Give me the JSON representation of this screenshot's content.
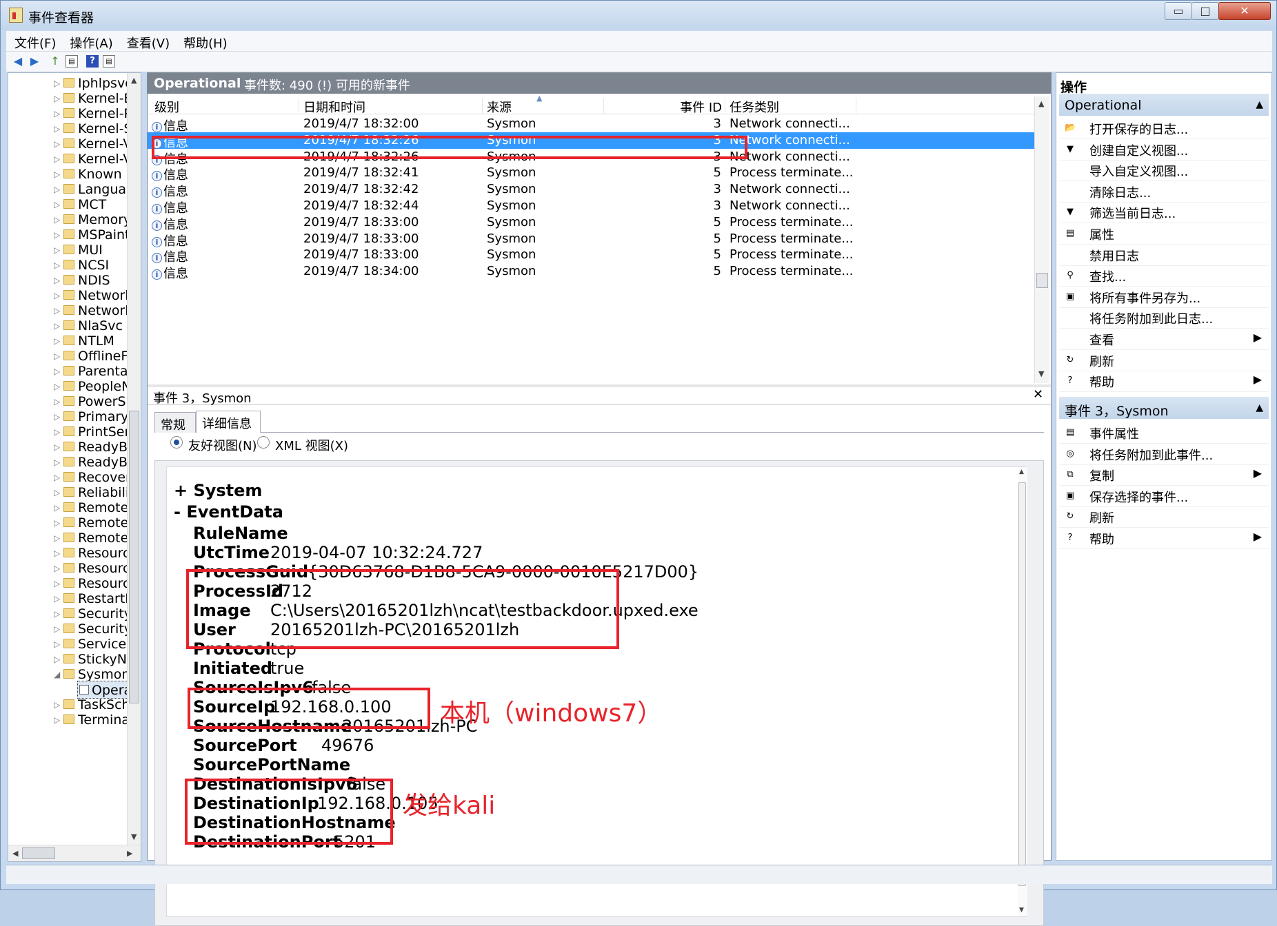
{
  "window": {
    "title": "事件查看器",
    "buttons": {
      "min": "▭",
      "max": "□",
      "close": "✕"
    }
  },
  "menu": [
    "文件(F)",
    "操作(A)",
    "查看(V)",
    "帮助(H)"
  ],
  "tree": {
    "items": [
      "Iphlpsvc",
      "Kernel-E",
      "Kernel-P",
      "Kernel-S",
      "Kernel-V",
      "Kernel-V",
      "Known I",
      "Languag",
      "MCT",
      "Memory",
      "MSPaint",
      "MUI",
      "NCSI",
      "NDIS",
      "Network",
      "Network",
      "NlaSvc",
      "NTLM",
      "OfflineF",
      "Parenta",
      "PeopleN",
      "PowerSh",
      "Primary",
      "PrintSer",
      "ReadyB",
      "ReadyB",
      "Recover",
      "Reliabili",
      "Remote",
      "Remote",
      "Remote",
      "Resourc",
      "Resourc",
      "Resourc",
      "RestartN",
      "Security",
      "Security",
      "Service",
      "StickyN",
      "Sysmon"
    ],
    "selected": "Opera",
    "after": [
      "TaskSch",
      "Termina"
    ]
  },
  "log": {
    "title": "Operational",
    "count_text": "事件数: 490 (!) 可用的新事件",
    "columns": [
      "级别",
      "日期和时间",
      "来源",
      "事件 ID",
      "任务类别"
    ],
    "rows": [
      {
        "level": "信息",
        "date": "2019/4/7 18:32:00",
        "source": "Sysmon",
        "id": "3",
        "task": "Network connecti..."
      },
      {
        "level": "信息",
        "date": "2019/4/7 18:32:26",
        "source": "Sysmon",
        "id": "3",
        "task": "Network connecti..."
      },
      {
        "level": "信息",
        "date": "2019/4/7 18:32:26",
        "source": "Sysmon",
        "id": "3",
        "task": "Network connecti..."
      },
      {
        "level": "信息",
        "date": "2019/4/7 18:32:41",
        "source": "Sysmon",
        "id": "5",
        "task": "Process terminate..."
      },
      {
        "level": "信息",
        "date": "2019/4/7 18:32:42",
        "source": "Sysmon",
        "id": "3",
        "task": "Network connecti..."
      },
      {
        "level": "信息",
        "date": "2019/4/7 18:32:44",
        "source": "Sysmon",
        "id": "3",
        "task": "Network connecti..."
      },
      {
        "level": "信息",
        "date": "2019/4/7 18:33:00",
        "source": "Sysmon",
        "id": "5",
        "task": "Process terminate..."
      },
      {
        "level": "信息",
        "date": "2019/4/7 18:33:00",
        "source": "Sysmon",
        "id": "5",
        "task": "Process terminate..."
      },
      {
        "level": "信息",
        "date": "2019/4/7 18:33:00",
        "source": "Sysmon",
        "id": "5",
        "task": "Process terminate..."
      },
      {
        "level": "信息",
        "date": "2019/4/7 18:34:00",
        "source": "Sysmon",
        "id": "5",
        "task": "Process terminate..."
      }
    ],
    "selected_row": 1
  },
  "detail": {
    "title": "事件 3，Sysmon",
    "close": "✕",
    "tabs": [
      "常规",
      "详细信息"
    ],
    "view_friendly": "友好视图(N)",
    "view_xml": "XML 视图(X)",
    "system_node": "+ System",
    "eventdata_node": "- EventData",
    "fields": [
      {
        "k": "RuleName",
        "v": ""
      },
      {
        "k": "UtcTime",
        "v": "2019-04-07 10:32:24.727"
      },
      {
        "k": "ProcessGuid",
        "v": "{30D63768-D1B8-5CA9-0000-0010E5217D00}"
      },
      {
        "k": "ProcessId",
        "v": "2712"
      },
      {
        "k": "Image",
        "v": "C:\\Users\\20165201lzh\\ncat\\testbackdoor.upxed.exe"
      },
      {
        "k": "User",
        "v": "20165201lzh-PC\\20165201lzh"
      },
      {
        "k": "Protocol",
        "v": "tcp"
      },
      {
        "k": "Initiated",
        "v": "true"
      },
      {
        "k": "SourceIsIpv6",
        "v": "false"
      },
      {
        "k": "SourceIp",
        "v": "192.168.0.100"
      },
      {
        "k": "SourceHostname",
        "v": "20165201lzh-PC"
      },
      {
        "k": "SourcePort",
        "v": "49676"
      },
      {
        "k": "SourcePortName",
        "v": ""
      },
      {
        "k": "DestinationIsIpv6",
        "v": "false"
      },
      {
        "k": "DestinationIp",
        "v": "192.168.0.105"
      },
      {
        "k": "DestinationHostname",
        "v": ""
      },
      {
        "k": "DestinationPort",
        "v": "5201"
      }
    ]
  },
  "annotations": {
    "local": "本机（windows7）",
    "to_kali": "发给kali",
    "color": "#e8232b"
  },
  "actions": {
    "title": "操作",
    "section1": "Operational",
    "items1": [
      {
        "icon": "open-log-icon",
        "glyph": "📂",
        "label": "打开保存的日志..."
      },
      {
        "icon": "filter-icon",
        "glyph": "▼",
        "label": "创建自定义视图..."
      },
      {
        "icon": "",
        "glyph": "",
        "label": "导入自定义视图..."
      },
      {
        "icon": "",
        "glyph": "",
        "label": "清除日志..."
      },
      {
        "icon": "filter-icon",
        "glyph": "▼",
        "label": "筛选当前日志..."
      },
      {
        "icon": "properties-icon",
        "glyph": "▤",
        "label": "属性"
      },
      {
        "icon": "",
        "glyph": "",
        "label": "禁用日志"
      },
      {
        "icon": "find-icon",
        "glyph": "⚲",
        "label": "查找..."
      },
      {
        "icon": "save-icon",
        "glyph": "▣",
        "label": "将所有事件另存为..."
      },
      {
        "icon": "",
        "glyph": "",
        "label": "将任务附加到此日志..."
      },
      {
        "icon": "",
        "glyph": "",
        "label": "查看",
        "sub": "▶"
      },
      {
        "icon": "refresh-icon",
        "glyph": "↻",
        "label": "刷新"
      },
      {
        "icon": "help-icon",
        "glyph": "?",
        "label": "帮助",
        "sub": "▶"
      }
    ],
    "section2": "事件 3，Sysmon",
    "items2": [
      {
        "icon": "event-properties-icon",
        "glyph": "▤",
        "label": "事件属性"
      },
      {
        "icon": "attach-task-icon",
        "glyph": "◎",
        "label": "将任务附加到此事件..."
      },
      {
        "icon": "copy-icon",
        "glyph": "⧉",
        "label": "复制",
        "sub": "▶"
      },
      {
        "icon": "save-icon",
        "glyph": "▣",
        "label": "保存选择的事件..."
      },
      {
        "icon": "refresh-icon",
        "glyph": "↻",
        "label": "刷新"
      },
      {
        "icon": "help-icon",
        "glyph": "?",
        "label": "帮助",
        "sub": "▶"
      }
    ]
  }
}
